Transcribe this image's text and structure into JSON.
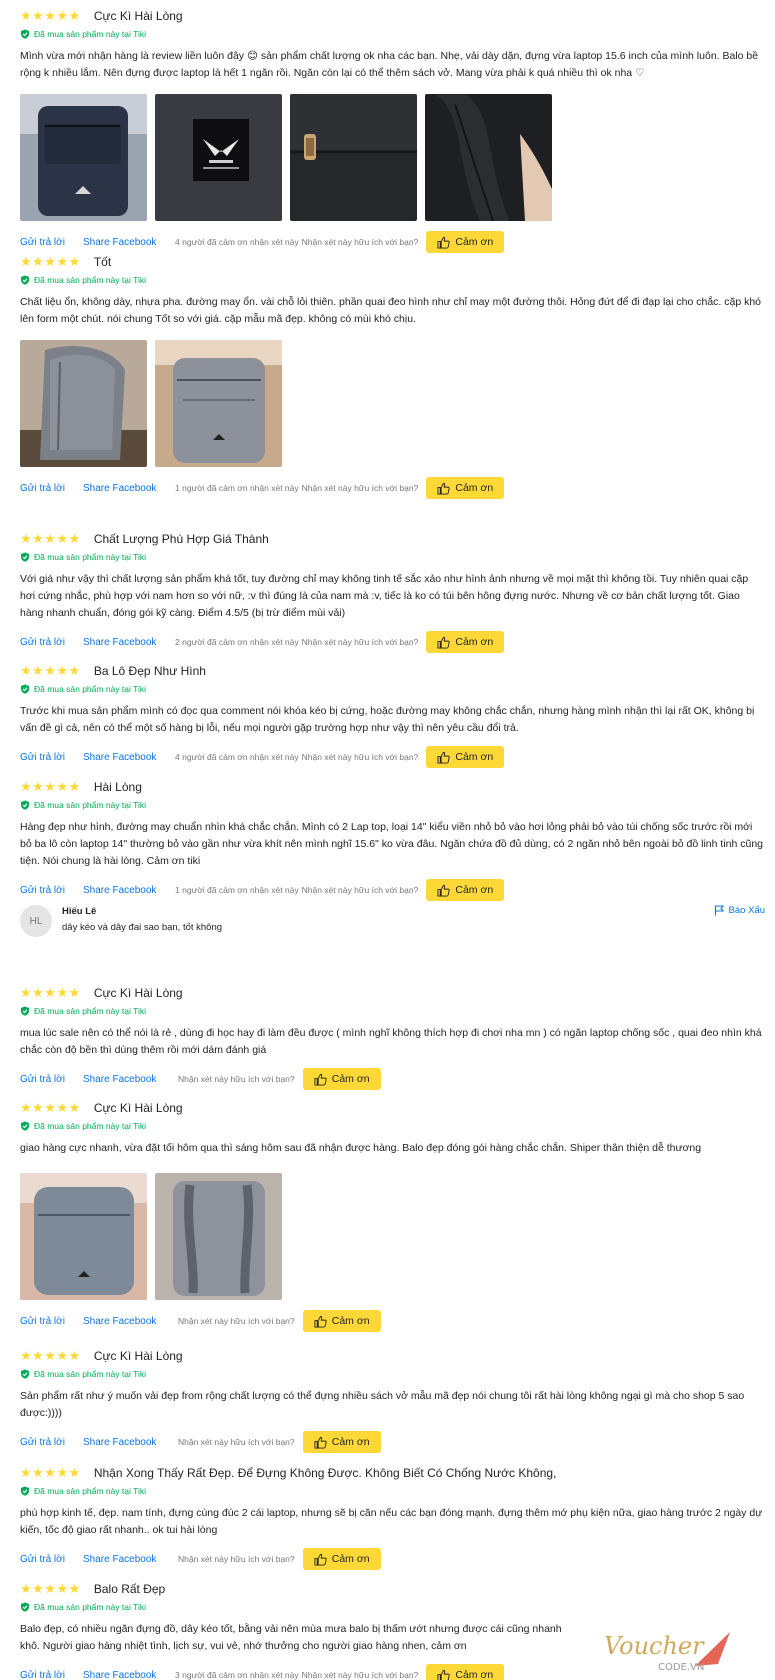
{
  "common": {
    "reply_label": "Gửi trả lời",
    "share_label": "Share Facebook",
    "helpful_question": "Nhận xét này hữu ích với bạn?",
    "thank_label": "Cảm ơn",
    "verified_text": "Đã mua sản phẩm này tại Tiki",
    "stars": "★★★★★"
  },
  "reviews": [
    {
      "rating": 5,
      "title": "Cực Kì Hài Lòng",
      "content": "Mình vừa mới nhận hàng là review liền luôn đây 😊 sản phẩm chất lượng ok nha các bạn. Nhẹ, vải dày dặn, đựng vừa laptop 15.6 inch của mình luôn. Balo bề rộng k nhiều lắm. Nên đựng được laptop là hết 1 ngăn rồi. Ngăn còn lại có thể thêm sách vở. Mang vừa phải k quá nhiều thì ok nha ♡",
      "thanks_count": "4 người đã cảm ơn nhận xét này",
      "images": [
        "navy backpack",
        "LAZA logo patch",
        "zipper pull",
        "backpack strap"
      ]
    },
    {
      "rating": 5,
      "title": "Tốt",
      "content": "Chất liệu ổn, không dày, nhựa pha. đường may ổn. vài chỗ lỏi thiên. phần quai đeo hình như chỉ may một đường thôi. Hỏng đứt để đi đạp lại cho chắc. cặp khó lên form một chút. nói chung Tốt so với giá. cặp mẫu mã đẹp. không có mùi khó chịu.",
      "thanks_count": "1 người đã cảm ơn nhận xét này",
      "images": [
        "grey backpack side",
        "grey backpack front"
      ]
    },
    {
      "rating": 5,
      "title": "Chất Lượng Phù Hợp Giá Thành",
      "content": "Với giá như vậy thì chất lượng sản phẩm khá tốt, tuy đường chỉ may không tinh tế sắc xảo như hình ảnh nhưng về mọi mặt thì không tồi. Tuy nhiên quai cặp hơi cứng nhắc, phù hợp với nam hơn so với nữ, :v thì đúng là của nam mà :v, tiếc là ko có túi bên hông đựng nước. Nhưng về cơ bản chất lượng tốt. Giao hàng nhanh chuẩn, đóng gói kỹ càng. Điểm 4.5/5 (bị trừ điểm mùi vải)",
      "thanks_count": "2 người đã cảm ơn nhận xét này",
      "images": []
    },
    {
      "rating": 5,
      "title": "Ba Lô Đẹp Như Hình",
      "content": "Trước khi mua sản phẩm mình có đọc qua comment nói khóa kéo bị cứng, hoặc đường may không chắc chắn, nhưng hàng mình nhận thì lại rất OK, không bị vấn đề gì cả, nên có thể một số hàng bị lỗi, nếu mọi người gặp trường hợp như vậy thì nên yêu cầu đổi trả.",
      "thanks_count": "4 người đã cảm ơn nhận xét này",
      "images": []
    },
    {
      "rating": 5,
      "title": "Hài Lòng",
      "content": "Hàng đẹp như hình, đường may chuẩn nhìn khá chắc chắn. Mình có 2 Lap top, loại 14\" kiểu viền nhỏ bỏ vào hơi lỏng phải bỏ vào túi chống sốc trước rồi mới bỏ ba lô còn laptop 14\" thường bỏ vào gần như vừa khít nên mình nghĩ 15.6\" ko vừa đâu. Ngăn chứa đồ đủ dùng, có 2 ngăn nhỏ bên ngoài bỏ đồ linh tinh cũng tiện. Nói chung là hài lòng. Cảm ơn tiki",
      "thanks_count": "1 người đã cảm ơn nhận xét này",
      "images": []
    },
    {
      "rating": 5,
      "title": "Cực Kì Hài Lòng",
      "content": "mua lúc sale nên có thể nói là rẻ , dùng đi học hay đi làm đều được ( mình nghĩ không thích hợp đi chơi nha mn ) có ngăn laptop chống sốc , quai đeo nhìn khá chắc còn độ bền thì dùng thêm rồi mới dám đánh giá",
      "thanks_count": "",
      "images": []
    },
    {
      "rating": 5,
      "title": "Cực Kì Hài Lòng",
      "content": "giao hàng cực nhanh, vừa đặt tối hôm qua thì sáng hôm sau đã nhận được hàng. Balo đẹp đóng gói hàng chắc chắn. Shiper thân thiện dễ thương",
      "thanks_count": "",
      "images": [
        "grey backpack front",
        "grey backpack back"
      ]
    },
    {
      "rating": 5,
      "title": "Cực Kì Hài Lòng",
      "content": "Sản phẩm rất như ý muốn vải đẹp from rộng chất lượng có thể đựng nhiều sách vở mẫu mã đẹp nói chung tôi rất hài lòng không ngại gì mà cho shop 5 sao được:))))",
      "thanks_count": "",
      "images": []
    },
    {
      "rating": 5,
      "title": "Nhận Xong Thấy Rất Đẹp. Để Đựng Không Được. Không Biết Có Chống Nước Không,",
      "content": "phù hợp kinh tế, đẹp. nam tính, đựng cùng đúc 2 cái laptop, nhưng sẽ bị căn nếu các bạn đóng mạnh. đựng thêm mớ phụ kiện nữa, giao hàng trước 2 ngày dự kiến, tốc độ giao rất nhanh.. ok tui hài lòng",
      "thanks_count": "",
      "images": []
    },
    {
      "rating": 5,
      "title": "Balo Rất Đẹp",
      "content": "Balo đẹp, có nhiều ngăn đựng đồ, dây kéo tốt, bằng vải nên mùa mưa balo bị thấm ướt nhưng được cái cũng nhanh khô. Người giao hàng nhiệt tình, lịch sự, vui vẻ, nhớ thưởng cho người giao hàng nhen, cảm ơn",
      "thanks_count": "3 người đã cảm ơn nhận xét này",
      "images": []
    }
  ],
  "comment": {
    "initials": "HL",
    "name": "Hiếu Lê",
    "text": "dây kéo và dây đai sao bạn, tốt không",
    "report_label": "Báo Xấu"
  },
  "watermark": {
    "brand": "Voucher",
    "sub": "CODE.VN"
  },
  "colors": {
    "star": "#fdd836",
    "verified": "#00ab56",
    "link": "#0b74e5",
    "button": "#fdd836",
    "muted": "#787878"
  }
}
